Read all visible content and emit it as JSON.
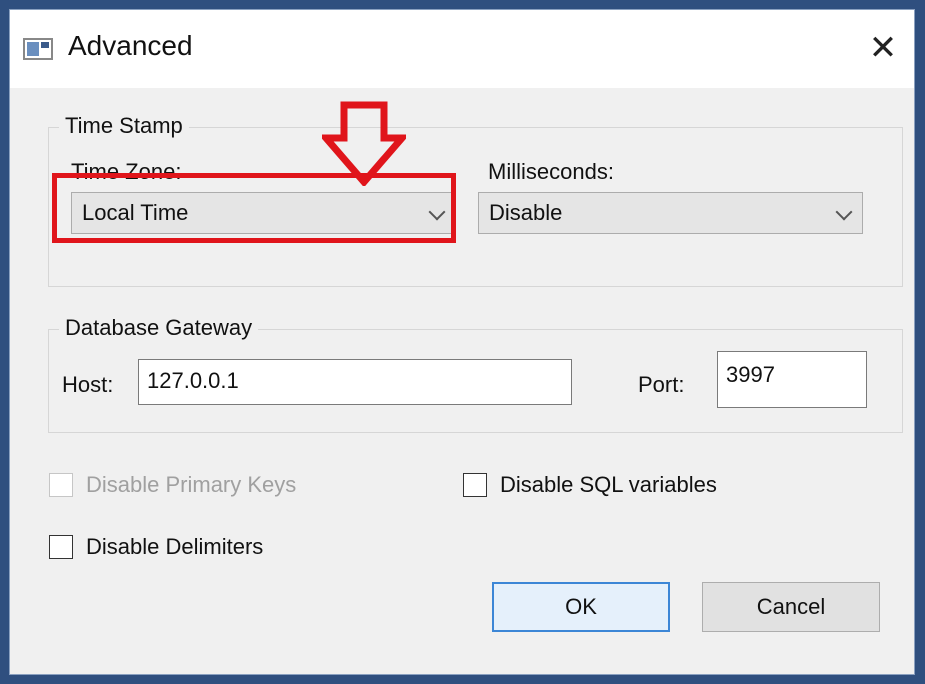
{
  "window": {
    "title": "Advanced",
    "close_glyph": "✕"
  },
  "time_stamp": {
    "group_label": "Time Stamp",
    "time_zone_label": "Time Zone:",
    "time_zone_value": "Local Time",
    "milliseconds_label": "Milliseconds:",
    "milliseconds_value": "Disable"
  },
  "database_gateway": {
    "group_label": "Database Gateway",
    "host_label": "Host:",
    "host_value": "127.0.0.1",
    "port_label": "Port:",
    "port_value": "3997"
  },
  "options": {
    "disable_primary_keys": {
      "label": "Disable Primary Keys",
      "checked": false,
      "enabled": false
    },
    "disable_sql_variables": {
      "label": "Disable SQL variables",
      "checked": false,
      "enabled": true
    },
    "disable_delimiters": {
      "label": "Disable Delimiters",
      "checked": false,
      "enabled": true
    }
  },
  "buttons": {
    "ok": "OK",
    "cancel": "Cancel"
  },
  "colors": {
    "highlight": "#e0151b",
    "window_frame": "#2f4f7f",
    "dialog_bg": "#f0f0f0"
  },
  "annotations": {
    "highlight_target": "time-zone-select",
    "arrow": "down-arrow-icon"
  }
}
